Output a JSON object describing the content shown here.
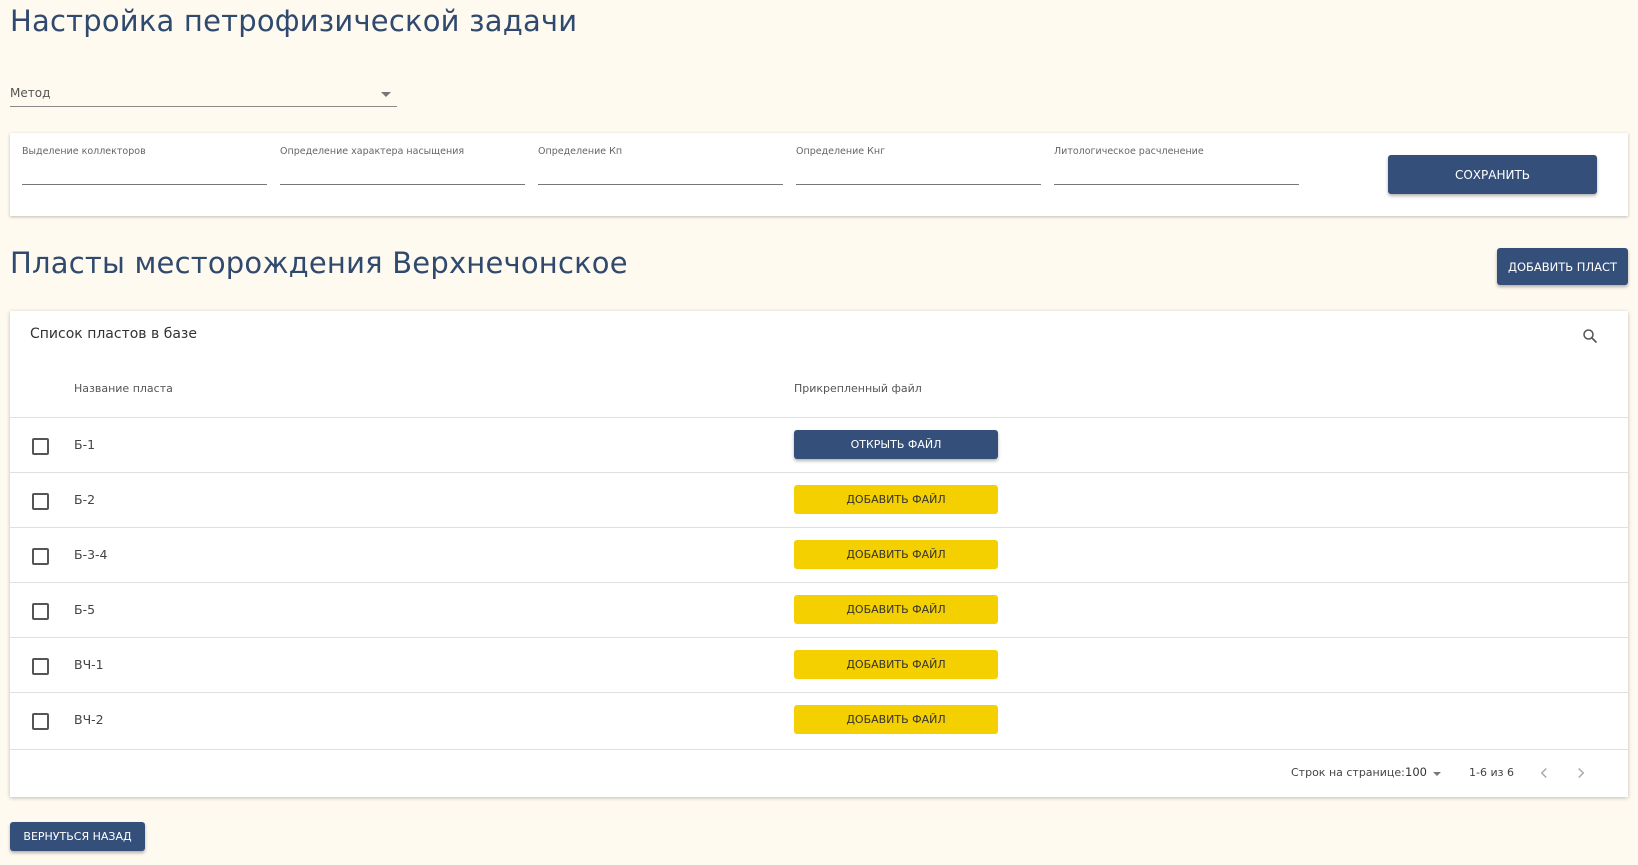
{
  "page": {
    "title": "Настройка петрофизической задачи"
  },
  "method": {
    "label": "Метод"
  },
  "settings": {
    "fields": [
      {
        "label": "Выделение коллекторов"
      },
      {
        "label": "Определение характера насыщения"
      },
      {
        "label": "Определение Кп"
      },
      {
        "label": "Определение Кнг"
      },
      {
        "label": "Литологическое расчленение"
      }
    ],
    "save_label": "Сохранить"
  },
  "layers_section": {
    "title": "Пласты месторождения Верхнечонское",
    "add_layer_label": "Добавить пласт"
  },
  "table": {
    "title": "Список пластов в базе",
    "columns": [
      "Название пласта",
      "Прикрепленный файл"
    ],
    "rows": [
      {
        "name": "Б-1",
        "action": "Открыть файл",
        "action_type": "open"
      },
      {
        "name": "Б-2",
        "action": "Добавить файл",
        "action_type": "add"
      },
      {
        "name": "Б-3-4",
        "action": "Добавить файл",
        "action_type": "add"
      },
      {
        "name": "Б-5",
        "action": "Добавить файл",
        "action_type": "add"
      },
      {
        "name": "ВЧ-1",
        "action": "Добавить файл",
        "action_type": "add"
      },
      {
        "name": "ВЧ-2",
        "action": "Добавить файл",
        "action_type": "add"
      }
    ],
    "pagination": {
      "rows_per_page_label": "Строк на странице:",
      "rows_per_page": "100",
      "range": "1-6 из 6"
    }
  },
  "back_label": "Вернуться назад",
  "colors": {
    "background": "#fffaf0",
    "primary": "#34507a",
    "accent": "#f5d000",
    "title": "#2f4a6e"
  },
  "icons": {
    "search": "search-icon",
    "prev": "chevron-left-icon",
    "next": "chevron-right-icon",
    "dropdown": "caret-down-icon"
  }
}
